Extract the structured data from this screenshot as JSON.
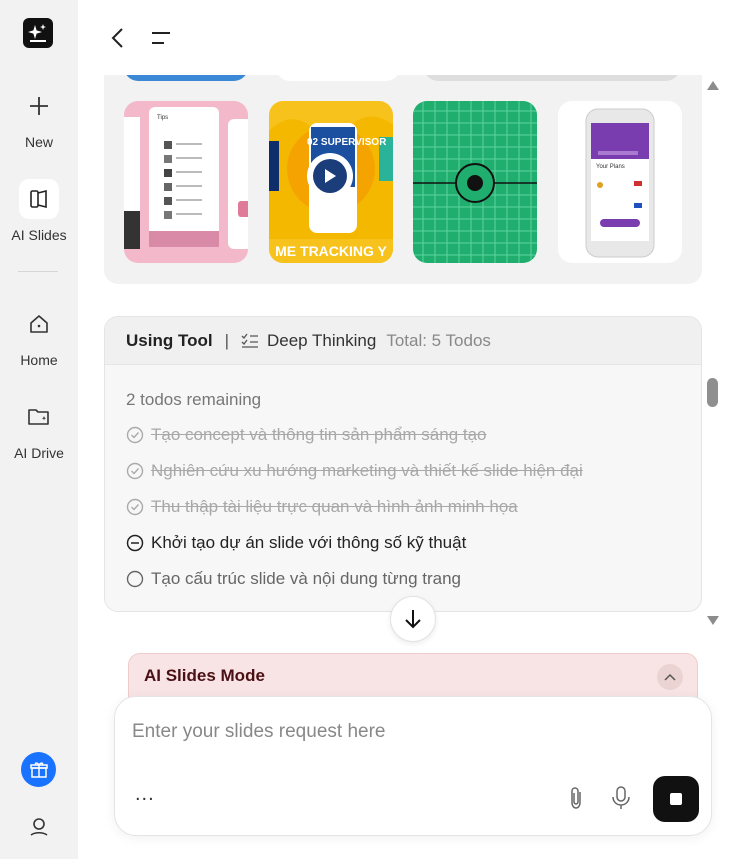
{
  "sidebar": {
    "items": [
      {
        "label": "New",
        "icon": "plus-icon"
      },
      {
        "label": "AI Slides",
        "icon": "slides-icon"
      },
      {
        "label": "Home",
        "icon": "home-icon"
      },
      {
        "label": "AI Drive",
        "icon": "folder-icon"
      }
    ]
  },
  "thumbnails": [
    {
      "title": "Tips",
      "icon": "tips-slide"
    },
    {
      "title": "02 SUPERVISOR",
      "caption": "ME TRACKING Y",
      "icon": "play-video-icon"
    },
    {
      "title": "",
      "icon": "grid-target-icon"
    },
    {
      "title": "Your Plans",
      "icon": "phone-app-icon"
    }
  ],
  "todo": {
    "tool_label": "Using Tool",
    "divider": "|",
    "mode_label": "Deep Thinking",
    "total_label": "Total: 5 Todos",
    "remaining_label": "2 todos remaining",
    "items": [
      {
        "text": "Tạo concept và thông tin sản phẩm sáng tạo",
        "status": "done"
      },
      {
        "text": "Nghiên cứu xu hướng marketing và thiết kế slide hiện đại",
        "status": "done"
      },
      {
        "text": "Thu thập tài liệu trực quan và hình ảnh minh họa",
        "status": "done"
      },
      {
        "text": "Khởi tạo dự án slide với thông số kỹ thuật",
        "status": "in-progress"
      },
      {
        "text": "Tạo cấu trúc slide và nội dung từng trang",
        "status": "pending"
      }
    ]
  },
  "mode_banner": {
    "label": "AI Slides Mode"
  },
  "composer": {
    "placeholder": "Enter your slides request here",
    "more_label": "..."
  },
  "colors": {
    "accent_blue": "#1a73ff",
    "mode_banner_bg": "#f8e4e4",
    "mode_banner_text": "#4b1015",
    "stop_button": "#111111"
  }
}
